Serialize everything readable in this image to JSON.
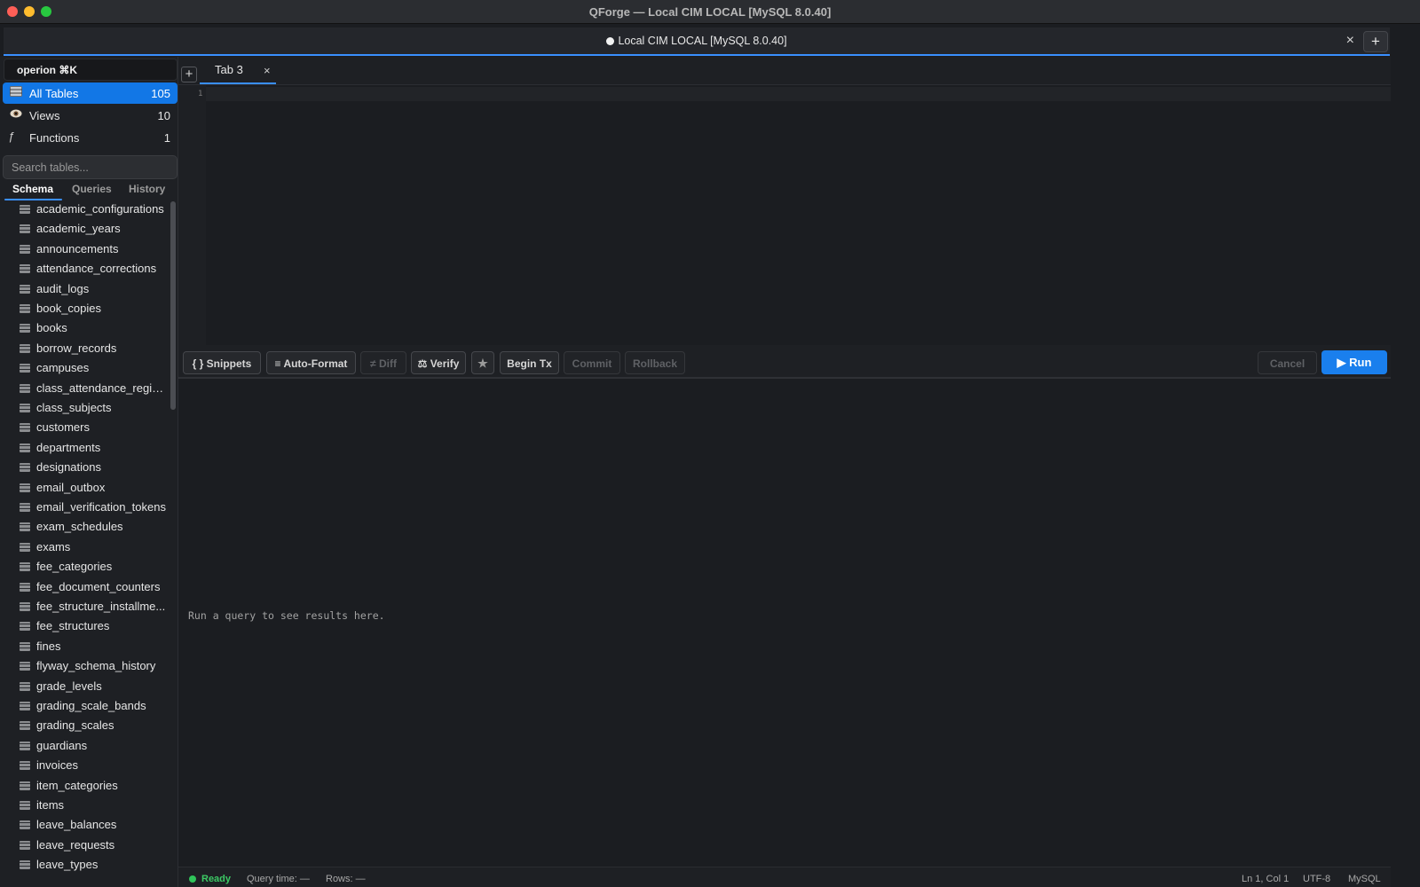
{
  "window": {
    "title": "QForge — Local CIM  LOCAL  [MySQL 8.0.40]"
  },
  "connection_tab": {
    "label": "Local CIM  LOCAL  [MySQL 8.0.40]",
    "close_icon": "×",
    "add_icon": "+"
  },
  "sidebar": {
    "command_palette": "operion  ⌘K",
    "nav": [
      {
        "label": "All Tables",
        "count": "105",
        "icon": "table-icon"
      },
      {
        "label": "Views",
        "count": "10",
        "icon": "eye-icon"
      },
      {
        "label": "Functions",
        "count": "1",
        "icon": "function-icon"
      }
    ],
    "search_placeholder": "Search tables...",
    "tabs": [
      "Schema",
      "Queries",
      "History"
    ],
    "tables": [
      "academic_configurations",
      "academic_years",
      "announcements",
      "attendance_corrections",
      "audit_logs",
      "book_copies",
      "books",
      "borrow_records",
      "campuses",
      "class_attendance_regis...",
      "class_subjects",
      "customers",
      "departments",
      "designations",
      "email_outbox",
      "email_verification_tokens",
      "exam_schedules",
      "exams",
      "fee_categories",
      "fee_document_counters",
      "fee_structure_installme...",
      "fee_structures",
      "fines",
      "flyway_schema_history",
      "grade_levels",
      "grading_scale_bands",
      "grading_scales",
      "guardians",
      "invoices",
      "item_categories",
      "items",
      "leave_balances",
      "leave_requests",
      "leave_types"
    ]
  },
  "editor": {
    "tab_label": "Tab 3",
    "tab_close": "×",
    "add_tab": "+",
    "line_number": "1"
  },
  "toolbar": {
    "snippets": "{ } Snippets",
    "auto_format": "≡ Auto-Format",
    "diff": "≠ Diff",
    "verify": "⚖ Verify",
    "star": "★",
    "begin_tx": "Begin Tx",
    "commit": "Commit",
    "rollback": "Rollback",
    "cancel": "Cancel",
    "run": "▶ Run"
  },
  "results": {
    "placeholder": "Run a query to see results here."
  },
  "statusbar": {
    "status": "Ready",
    "query_time": "Query time: —",
    "rows": "Rows: —",
    "cursor": "Ln 1, Col 1",
    "encoding": "UTF-8",
    "dialect": "MySQL"
  },
  "colors": {
    "accent": "#1a7fed",
    "ready": "#30c45a"
  }
}
